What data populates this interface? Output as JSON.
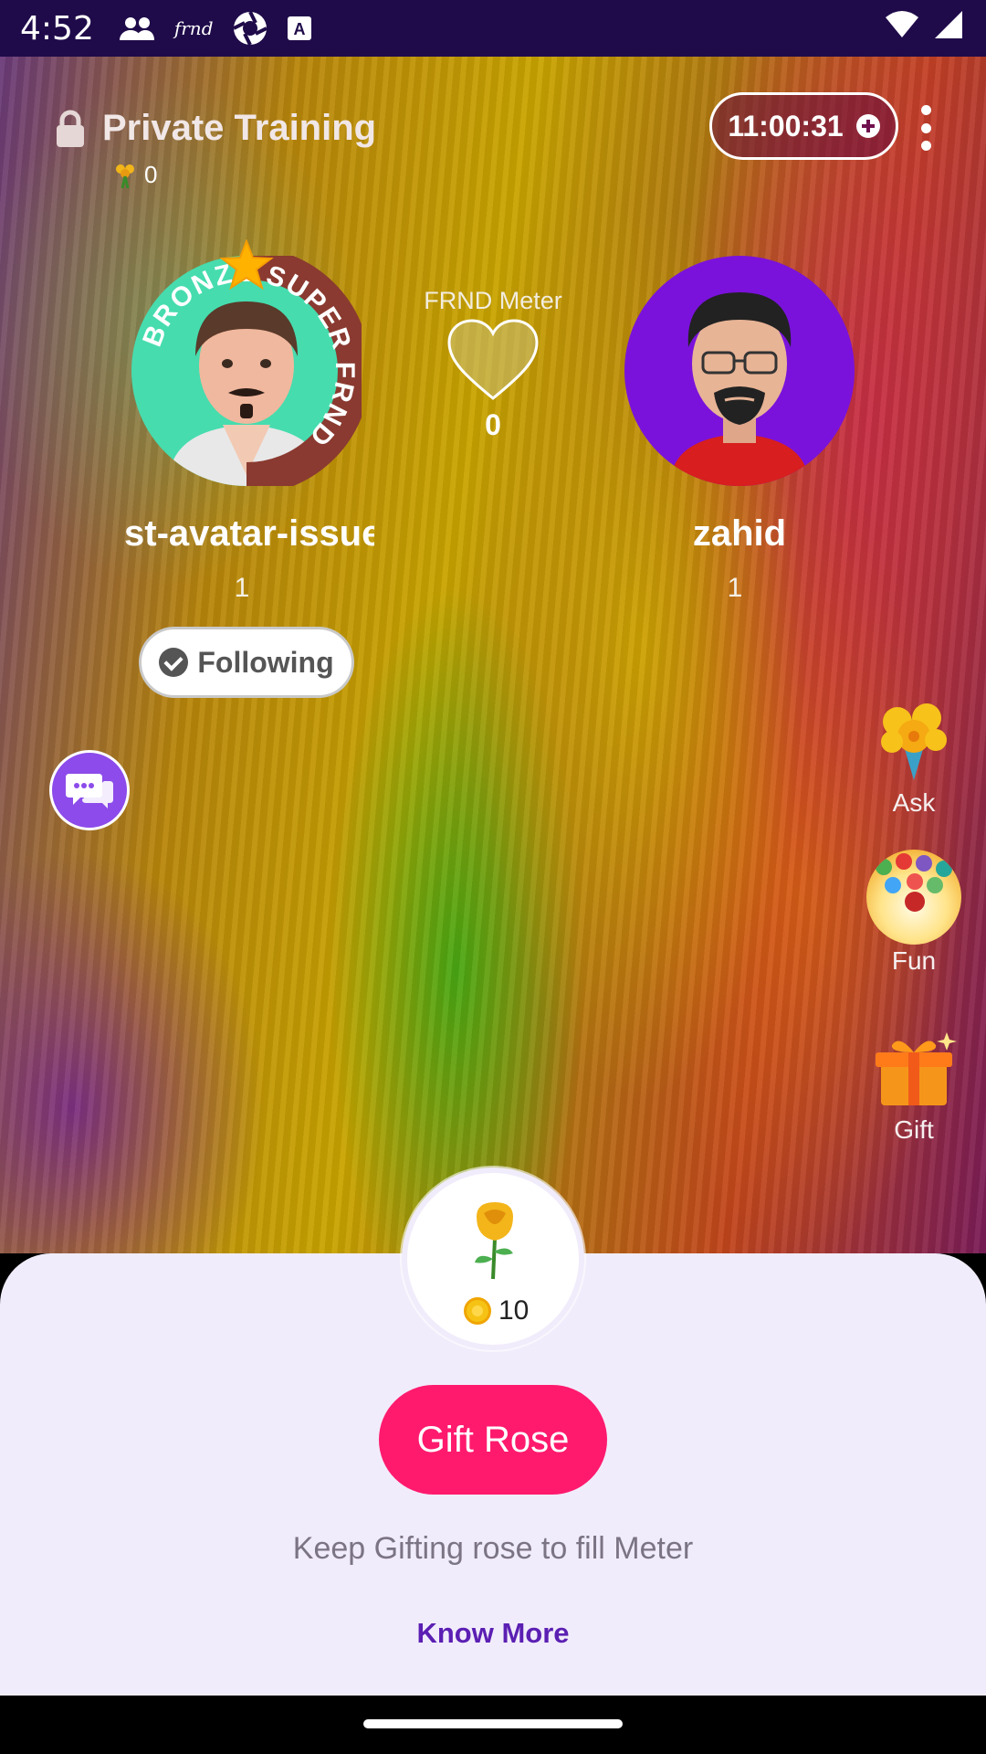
{
  "status_bar": {
    "time": "4:52",
    "icons": [
      "people-icon",
      "frnd-icon",
      "aperture-icon",
      "font-icon",
      "wifi-icon",
      "signal-icon"
    ],
    "frnd_glyph": "frnd"
  },
  "header": {
    "title": "Private Training",
    "rose_count": "0",
    "timer": "11:00:31"
  },
  "users": {
    "left": {
      "name": "st-avatar-issue",
      "level": "1",
      "badge_text": "BRONZE SUPER FRND",
      "follow_label": "Following"
    },
    "right": {
      "name": "zahid",
      "level": "1"
    }
  },
  "meter": {
    "label": "FRND Meter",
    "value": "0"
  },
  "rail": {
    "ask": "Ask",
    "fun": "Fun",
    "gift": "Gift"
  },
  "sheet": {
    "rose_cost": "10",
    "gift_button": "Gift Rose",
    "hint": "Keep Gifting rose to fill Meter",
    "know_more": "Know More"
  },
  "colors": {
    "status_bar": "#1f0b4a",
    "gift_button": "#ff1a6e",
    "link": "#5b1fb3",
    "sheet": "#f1ecfb",
    "chat_button": "#8c4bea"
  }
}
